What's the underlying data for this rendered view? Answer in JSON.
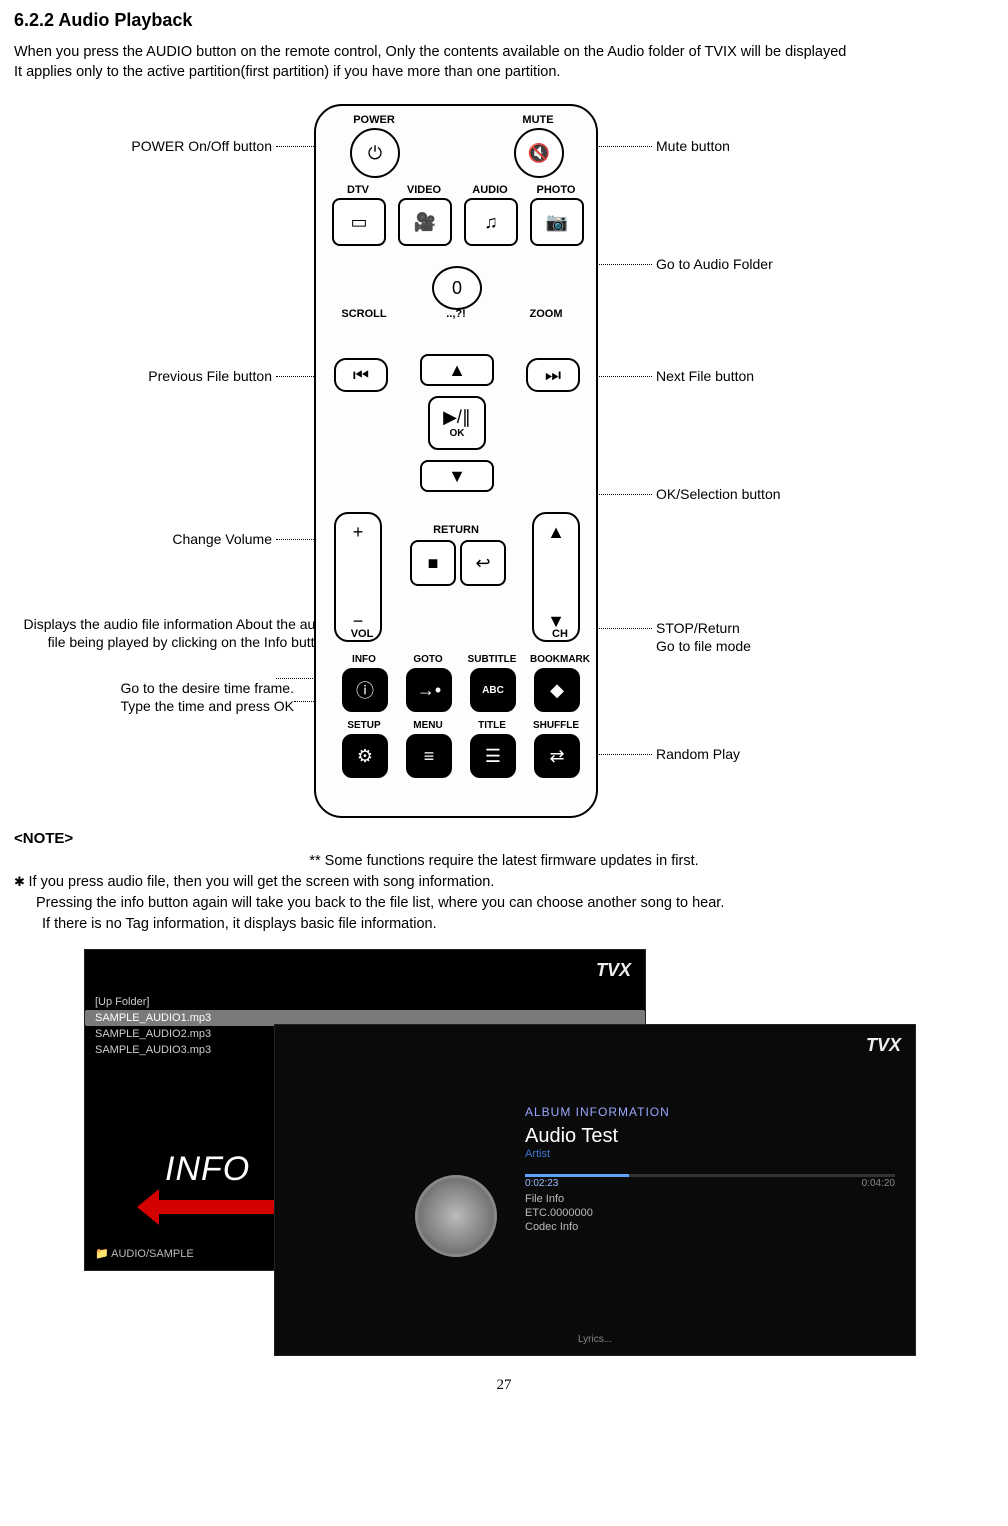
{
  "heading": "6.2.2  Audio Playback",
  "intro_line1": "When you press the AUDIO button on the remote control, Only the contents available on the Audio folder of TVIX will be displayed",
  "intro_line2": "It applies only to the active partition(first partition) if you have more than one partition.",
  "remote": {
    "labels": {
      "power": "POWER",
      "mute": "MUTE",
      "dtv": "DTV",
      "video": "VIDEO",
      "audio": "AUDIO",
      "photo": "PHOTO",
      "scroll": "SCROLL",
      "zero_sub": "..,?!",
      "zoom": "ZOOM",
      "ok": "OK",
      "vol": "VOL",
      "ch": "CH",
      "return": "RETURN",
      "info": "INFO",
      "goto": "GOTO",
      "subtitle": "SUBTITLE",
      "bookmark": "BOOKMARK",
      "setup": "SETUP",
      "menu": "MENU",
      "title": "TITLE",
      "shuffle": "SHUFFLE"
    },
    "icons": {
      "power": "⏻",
      "mute": "🔇",
      "dtv": "▭",
      "video": "🎥",
      "audio": "♫",
      "photo": "📷",
      "prev": "⏮",
      "zero": "0",
      "next": "⏭",
      "up": "▲",
      "down": "▼",
      "play": "▶/∥",
      "plus": "+",
      "minus": "−",
      "ret1": "■",
      "ret2": "↩",
      "info": "ⓘ",
      "goto": "→•",
      "subtitle": "ABC",
      "bookmark": "◆",
      "setup": "⚙",
      "menu": "≡",
      "title": "☰",
      "shuffle": "⇄"
    }
  },
  "callouts": {
    "power": "POWER On/Off button",
    "mute": "Mute button",
    "audio_folder": "Go to Audio Folder",
    "prev": "Previous File button",
    "next": "Next File button",
    "ok": "OK/Selection button",
    "volume": "Change Volume",
    "info1": "Displays the audio file information About the audio file being  played by clicking on the Info button.",
    "goto1": "Go to the desire time frame.",
    "goto2": "Type the time and press OK",
    "stop1": "STOP/Return",
    "stop2": "Go to file mode",
    "random": "Random Play"
  },
  "note": {
    "title": "<NOTE>",
    "firmware": "** Some functions require the latest firmware updates in first.",
    "b1": "If you press audio file, then you will get the screen with song information.",
    "b2": "Pressing the info button again will take you back to the file list, where you can choose another song to hear.",
    "b3": "If there is no Tag information, it displays basic file information."
  },
  "screenshot": {
    "brand": "TVX",
    "up_folder": "[Up Folder]",
    "files": [
      "SAMPLE_AUDIO1.mp3",
      "SAMPLE_AUDIO2.mp3",
      "SAMPLE_AUDIO3.mp3"
    ],
    "folder_path": "AUDIO/SAMPLE",
    "info_label": "INFO",
    "album_header": "ALBUM INFORMATION",
    "album_title": "Audio Test",
    "album_artist": "Artist",
    "time_l": "0:02:23",
    "time_r": "0:04:20",
    "file_info": "File Info",
    "etc": "ETC.0000000",
    "codec": "Codec Info",
    "lyrics": "Lyrics..."
  },
  "page_number": "27"
}
